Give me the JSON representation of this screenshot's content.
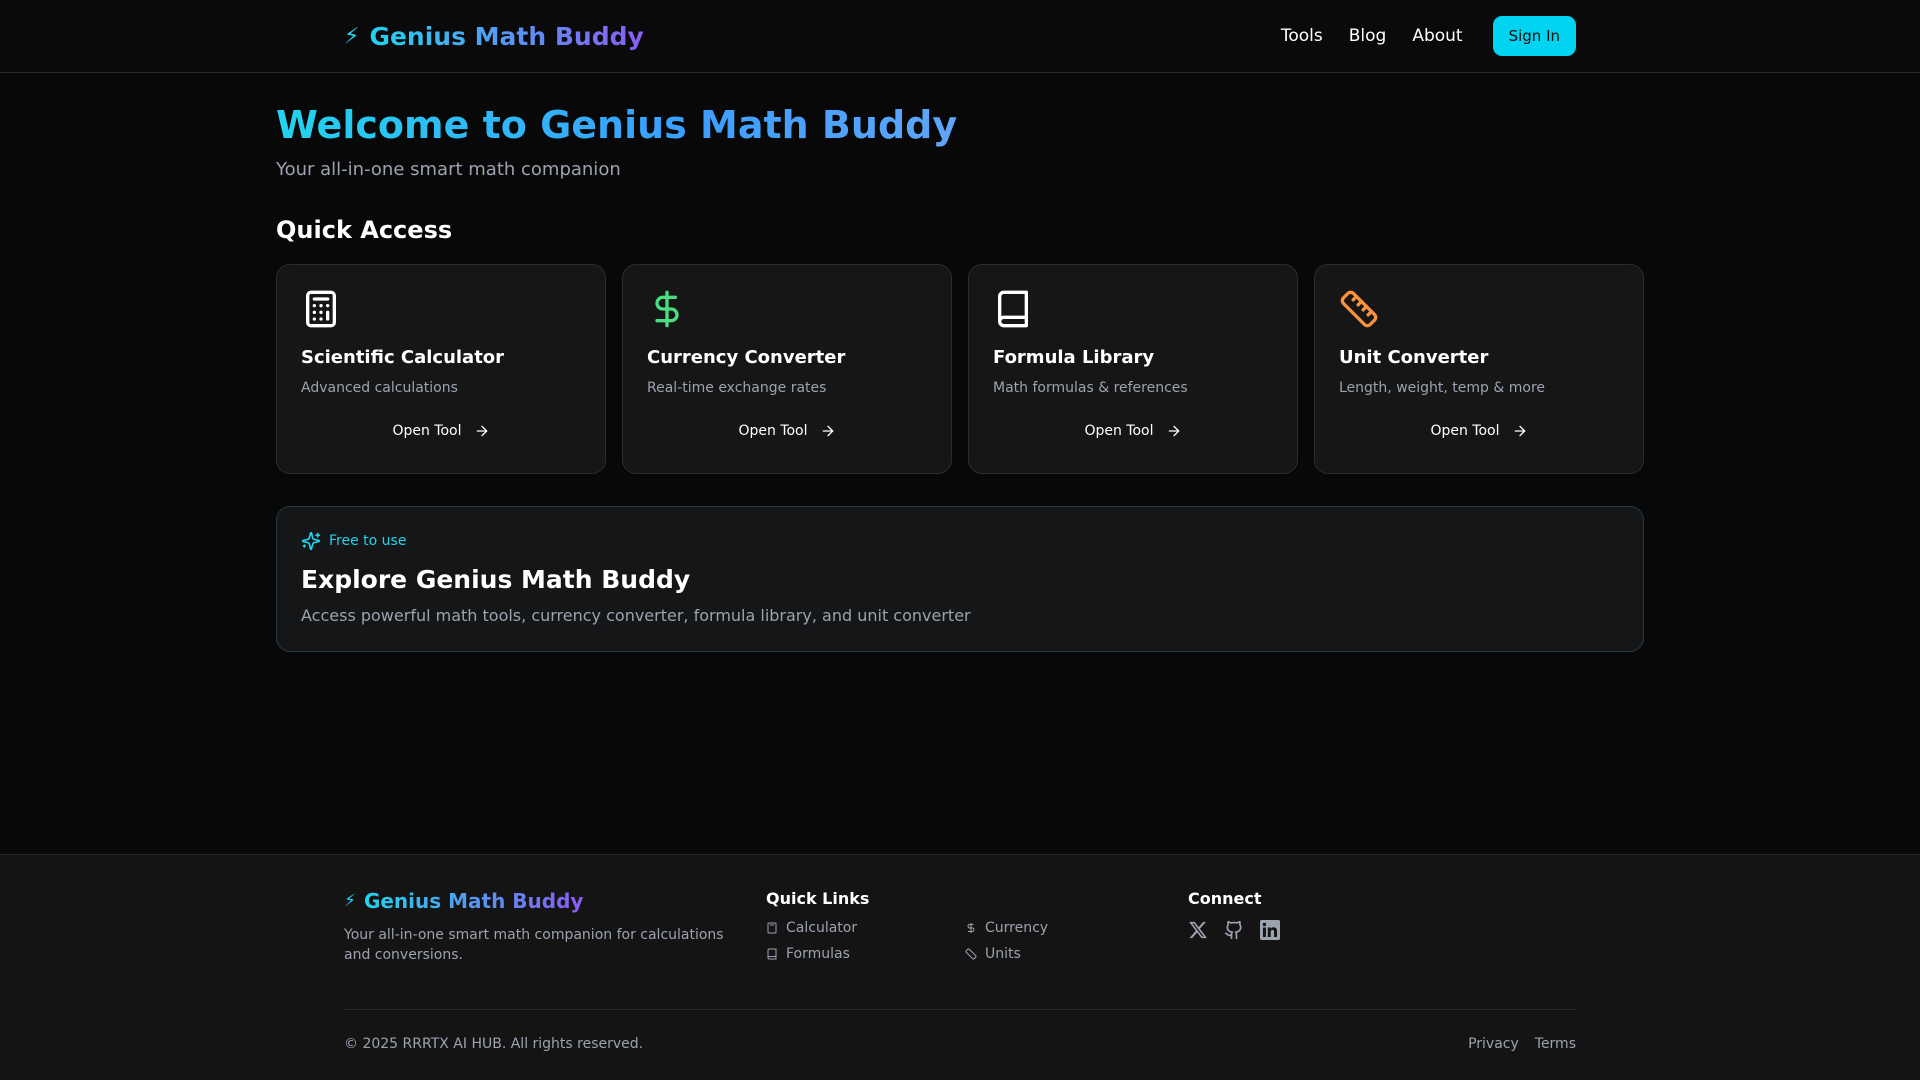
{
  "header": {
    "brand": "Genius Math Buddy",
    "nav": [
      "Tools",
      "Blog",
      "About"
    ],
    "signin_label": "Sign In"
  },
  "hero": {
    "title": "Welcome to Genius Math Buddy",
    "subtitle": "Your all-in-one smart math companion"
  },
  "quick_access": {
    "title": "Quick Access",
    "cards": [
      {
        "title": "Scientific Calculator",
        "desc": "Advanced calculations",
        "button": "Open Tool",
        "icon": "calculator-icon",
        "color": "#ffffff"
      },
      {
        "title": "Currency Converter",
        "desc": "Real-time exchange rates",
        "button": "Open Tool",
        "icon": "dollar-icon",
        "color": "#4ade80"
      },
      {
        "title": "Formula Library",
        "desc": "Math formulas & references",
        "button": "Open Tool",
        "icon": "book-icon",
        "color": "#ffffff"
      },
      {
        "title": "Unit Converter",
        "desc": "Length, weight, temp & more",
        "button": "Open Tool",
        "icon": "ruler-icon",
        "color": "#fb923c"
      }
    ]
  },
  "explore": {
    "badge": "Free to use",
    "title": "Explore Genius Math Buddy",
    "desc": "Access powerful math tools, currency converter, formula library, and unit converter"
  },
  "footer": {
    "brand": "Genius Math Buddy",
    "desc": "Your all-in-one smart math companion for calculations and conversions.",
    "quick_links_title": "Quick Links",
    "links": [
      "Calculator",
      "Currency",
      "Formulas",
      "Units"
    ],
    "connect_title": "Connect",
    "social": [
      "x-icon",
      "github-icon",
      "linkedin-icon"
    ],
    "copyright": "© 2025 RRRTX AI HUB. All rights reserved.",
    "legal": [
      "Privacy",
      "Terms"
    ]
  },
  "colors": {
    "accent": "#22d3ee",
    "gradient_end": "#8b5cf6",
    "background": "#080808"
  }
}
